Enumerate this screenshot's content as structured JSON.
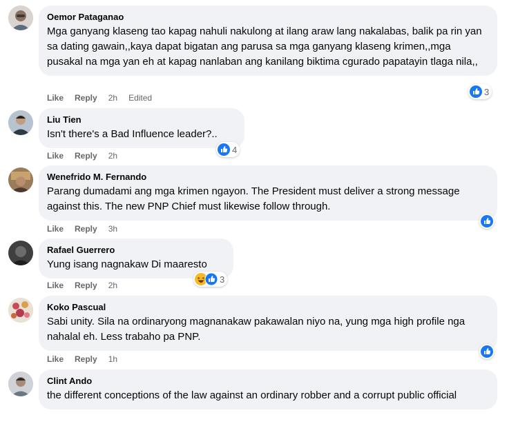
{
  "actions": {
    "like": "Like",
    "reply": "Reply"
  },
  "colors": {
    "like_blue": "#1877f2",
    "bubble": "#f0f2f5",
    "meta": "#65676b"
  },
  "comments": [
    {
      "author": "Oemor Pataganao",
      "text": "Mga ganyang klaseng tao kapag nahuli nakulong at ilang araw lang nakalabas, balik pa rin yan sa dating gawain,,kaya dapat bigatan ang parusa sa mga ganyang klaseng krimen,,mga pusakal na mga yan eh at kapag nanlaban ang kanilang biktima cgurado papatayin tlaga nila,,",
      "time": "2h",
      "edited": "Edited",
      "reactions": {
        "icons": [
          "like-icon"
        ],
        "count": "3"
      }
    },
    {
      "author": "Liu Tien",
      "text": "Isn't there's a Bad Influence leader?..",
      "time": "2h",
      "reactions": {
        "icons": [
          "like-icon"
        ],
        "count": "4"
      }
    },
    {
      "author": "Wenefrido M. Fernando",
      "text": "Parang dumadami ang mga krimen ngayon. The President must deliver a strong message against this. The new PNP Chief must likewise follow through.",
      "time": "3h",
      "reactions": {
        "icons": [
          "like-icon"
        ],
        "count": ""
      }
    },
    {
      "author": "Rafael Guerrero",
      "text": "Yung isang nagnakaw Di maaresto",
      "time": "2h",
      "reactions": {
        "icons": [
          "haha-icon",
          "like-icon"
        ],
        "count": "3"
      }
    },
    {
      "author": "Koko Pascual",
      "text": "Sabi unity. Sila na ordinaryong magnanakaw pakawalan niyo na, yung mga high profile nga nahalal eh. Less trabaho pa PNP.",
      "time": "1h",
      "reactions": {
        "icons": [
          "like-icon"
        ],
        "count": ""
      }
    },
    {
      "author": "Clint Ando",
      "text": "the different conceptions of the law against an ordinary robber and a corrupt public official"
    }
  ]
}
